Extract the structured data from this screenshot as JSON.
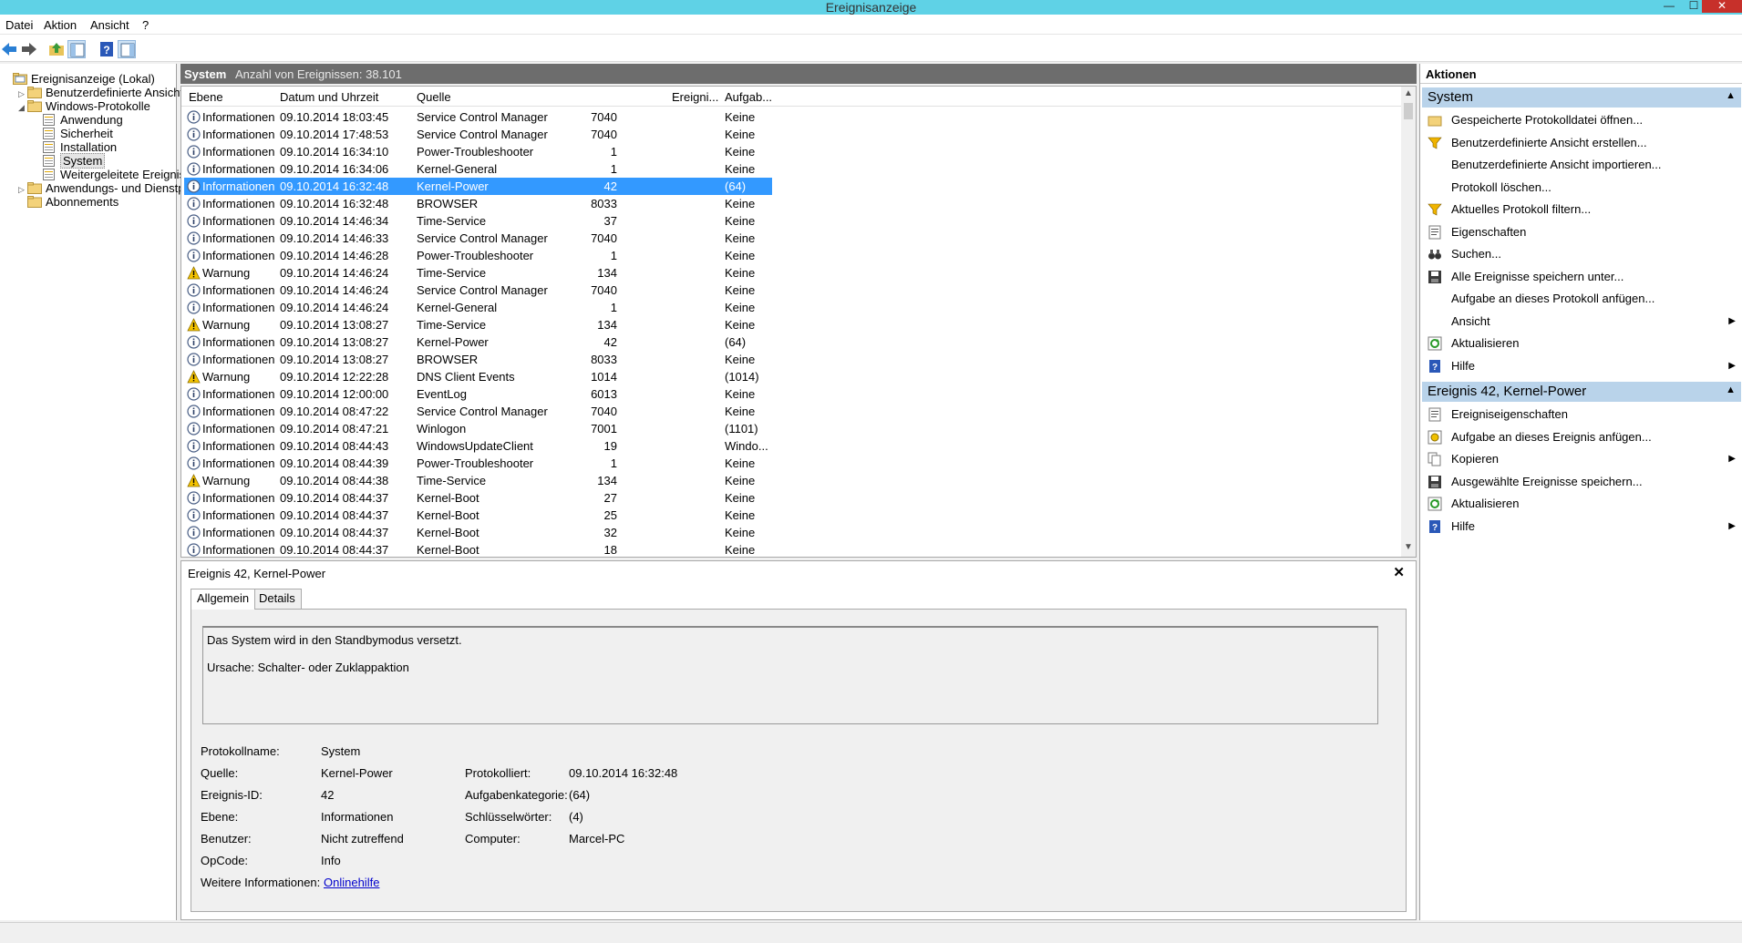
{
  "window": {
    "title": "Ereignisanzeige",
    "min": "—",
    "max": "☐",
    "close": "✕"
  },
  "menu": [
    "Datei",
    "Aktion",
    "Ansicht",
    "?"
  ],
  "tree": {
    "items": [
      {
        "label": "Ereignisanzeige (Lokal)",
        "level": 0,
        "expander": ""
      },
      {
        "label": "Benutzerdefinierte Ansichten",
        "level": 1,
        "expander": "▷"
      },
      {
        "label": "Windows-Protokolle",
        "level": 1,
        "expander": "◢"
      },
      {
        "label": "Anwendung",
        "level": 2,
        "expander": ""
      },
      {
        "label": "Sicherheit",
        "level": 2,
        "expander": ""
      },
      {
        "label": "Installation",
        "level": 2,
        "expander": ""
      },
      {
        "label": "System",
        "level": 2,
        "expander": "",
        "selected": true
      },
      {
        "label": "Weitergeleitete Ereignisse",
        "level": 2,
        "expander": ""
      },
      {
        "label": "Anwendungs- und Dienstprotokolle",
        "level": 1,
        "expander": "▷"
      },
      {
        "label": "Abonnements",
        "level": 1,
        "expander": ""
      }
    ],
    "scroll_left": "<",
    "scroll_right": ">"
  },
  "center": {
    "log_name": "System",
    "count_text": "Anzahl von Ereignissen: 38.101",
    "columns": [
      "Ebene",
      "Datum und Uhrzeit",
      "Quelle",
      "Ereigni...",
      "Aufgab..."
    ],
    "rows": [
      {
        "level": "Informationen",
        "type": "info",
        "datetime": "09.10.2014 18:03:45",
        "source": "Service Control Manager",
        "id": "7040",
        "category": "Keine"
      },
      {
        "level": "Informationen",
        "type": "info",
        "datetime": "09.10.2014 17:48:53",
        "source": "Service Control Manager",
        "id": "7040",
        "category": "Keine"
      },
      {
        "level": "Informationen",
        "type": "info",
        "datetime": "09.10.2014 16:34:10",
        "source": "Power-Troubleshooter",
        "id": "1",
        "category": "Keine"
      },
      {
        "level": "Informationen",
        "type": "info",
        "datetime": "09.10.2014 16:34:06",
        "source": "Kernel-General",
        "id": "1",
        "category": "Keine"
      },
      {
        "level": "Informationen",
        "type": "info",
        "datetime": "09.10.2014 16:32:48",
        "source": "Kernel-Power",
        "id": "42",
        "category": "(64)",
        "selected": true
      },
      {
        "level": "Informationen",
        "type": "info",
        "datetime": "09.10.2014 16:32:48",
        "source": "BROWSER",
        "id": "8033",
        "category": "Keine"
      },
      {
        "level": "Informationen",
        "type": "info",
        "datetime": "09.10.2014 14:46:34",
        "source": "Time-Service",
        "id": "37",
        "category": "Keine"
      },
      {
        "level": "Informationen",
        "type": "info",
        "datetime": "09.10.2014 14:46:33",
        "source": "Service Control Manager",
        "id": "7040",
        "category": "Keine"
      },
      {
        "level": "Informationen",
        "type": "info",
        "datetime": "09.10.2014 14:46:28",
        "source": "Power-Troubleshooter",
        "id": "1",
        "category": "Keine"
      },
      {
        "level": "Warnung",
        "type": "warn",
        "datetime": "09.10.2014 14:46:24",
        "source": "Time-Service",
        "id": "134",
        "category": "Keine"
      },
      {
        "level": "Informationen",
        "type": "info",
        "datetime": "09.10.2014 14:46:24",
        "source": "Service Control Manager",
        "id": "7040",
        "category": "Keine"
      },
      {
        "level": "Informationen",
        "type": "info",
        "datetime": "09.10.2014 14:46:24",
        "source": "Kernel-General",
        "id": "1",
        "category": "Keine"
      },
      {
        "level": "Warnung",
        "type": "warn",
        "datetime": "09.10.2014 13:08:27",
        "source": "Time-Service",
        "id": "134",
        "category": "Keine"
      },
      {
        "level": "Informationen",
        "type": "info",
        "datetime": "09.10.2014 13:08:27",
        "source": "Kernel-Power",
        "id": "42",
        "category": "(64)"
      },
      {
        "level": "Informationen",
        "type": "info",
        "datetime": "09.10.2014 13:08:27",
        "source": "BROWSER",
        "id": "8033",
        "category": "Keine"
      },
      {
        "level": "Warnung",
        "type": "warn",
        "datetime": "09.10.2014 12:22:28",
        "source": "DNS Client Events",
        "id": "1014",
        "category": "(1014)"
      },
      {
        "level": "Informationen",
        "type": "info",
        "datetime": "09.10.2014 12:00:00",
        "source": "EventLog",
        "id": "6013",
        "category": "Keine"
      },
      {
        "level": "Informationen",
        "type": "info",
        "datetime": "09.10.2014 08:47:22",
        "source": "Service Control Manager",
        "id": "7040",
        "category": "Keine"
      },
      {
        "level": "Informationen",
        "type": "info",
        "datetime": "09.10.2014 08:47:21",
        "source": "Winlogon",
        "id": "7001",
        "category": "(1101)"
      },
      {
        "level": "Informationen",
        "type": "info",
        "datetime": "09.10.2014 08:44:43",
        "source": "WindowsUpdateClient",
        "id": "19",
        "category": "Windo..."
      },
      {
        "level": "Informationen",
        "type": "info",
        "datetime": "09.10.2014 08:44:39",
        "source": "Power-Troubleshooter",
        "id": "1",
        "category": "Keine"
      },
      {
        "level": "Warnung",
        "type": "warn",
        "datetime": "09.10.2014 08:44:38",
        "source": "Time-Service",
        "id": "134",
        "category": "Keine"
      },
      {
        "level": "Informationen",
        "type": "info",
        "datetime": "09.10.2014 08:44:37",
        "source": "Kernel-Boot",
        "id": "27",
        "category": "Keine"
      },
      {
        "level": "Informationen",
        "type": "info",
        "datetime": "09.10.2014 08:44:37",
        "source": "Kernel-Boot",
        "id": "25",
        "category": "Keine"
      },
      {
        "level": "Informationen",
        "type": "info",
        "datetime": "09.10.2014 08:44:37",
        "source": "Kernel-Boot",
        "id": "32",
        "category": "Keine"
      },
      {
        "level": "Informationen",
        "type": "info",
        "datetime": "09.10.2014 08:44:37",
        "source": "Kernel-Boot",
        "id": "18",
        "category": "Keine"
      }
    ]
  },
  "detail": {
    "title": "Ereignis 42, Kernel-Power",
    "close": "✕",
    "tabs": [
      "Allgemein",
      "Details"
    ],
    "message_line1": "Das System wird in den Standbymodus versetzt.",
    "message_line2": "Ursache: Schalter- oder Zuklappaktion",
    "fields": {
      "protokollname_label": "Protokollname:",
      "protokollname": "System",
      "quelle_label": "Quelle:",
      "quelle": "Kernel-Power",
      "protokolliert_label": "Protokolliert:",
      "protokolliert": "09.10.2014 16:32:48",
      "ereignisid_label": "Ereignis-ID:",
      "ereignisid": "42",
      "aufgabe_label": "Aufgabenkategorie:",
      "aufgabe": "(64)",
      "ebene_label": "Ebene:",
      "ebene": "Informationen",
      "schluessel_label": "Schlüsselwörter:",
      "schluessel": "(4)",
      "benutzer_label": "Benutzer:",
      "benutzer": "Nicht zutreffend",
      "computer_label": "Computer:",
      "computer": "Marcel-PC",
      "opcode_label": "OpCode:",
      "opcode": "Info",
      "weitere_label": "Weitere Informationen:",
      "weitere_link": "Onlinehilfe"
    }
  },
  "actions": {
    "title": "Aktionen",
    "section1": {
      "title": "System",
      "items": [
        {
          "label": "Gespeicherte Protokolldatei öffnen...",
          "icon": "folder-open-icon",
          "sub": false
        },
        {
          "label": "Benutzerdefinierte Ansicht erstellen...",
          "icon": "filter-icon",
          "sub": false
        },
        {
          "label": "Benutzerdefinierte Ansicht importieren...",
          "icon": "",
          "sub": false
        },
        {
          "label": "Protokoll löschen...",
          "icon": "",
          "sub": false
        },
        {
          "label": "Aktuelles Protokoll filtern...",
          "icon": "filter-icon",
          "sub": false
        },
        {
          "label": "Eigenschaften",
          "icon": "properties-icon",
          "sub": false
        },
        {
          "label": "Suchen...",
          "icon": "binoculars-icon",
          "sub": false
        },
        {
          "label": "Alle Ereignisse speichern unter...",
          "icon": "save-icon",
          "sub": false
        },
        {
          "label": "Aufgabe an dieses Protokoll anfügen...",
          "icon": "",
          "sub": false
        },
        {
          "label": "Ansicht",
          "icon": "",
          "sub": true
        },
        {
          "label": "Aktualisieren",
          "icon": "refresh-icon",
          "sub": false
        },
        {
          "label": "Hilfe",
          "icon": "help-icon",
          "sub": true
        }
      ]
    },
    "section2": {
      "title": "Ereignis 42, Kernel-Power",
      "items": [
        {
          "label": "Ereigniseigenschaften",
          "icon": "properties-icon",
          "sub": false
        },
        {
          "label": "Aufgabe an dieses Ereignis anfügen...",
          "icon": "task-icon",
          "sub": false
        },
        {
          "label": "Kopieren",
          "icon": "copy-icon",
          "sub": true
        },
        {
          "label": "Ausgewählte Ereignisse speichern...",
          "icon": "save-icon",
          "sub": false
        },
        {
          "label": "Aktualisieren",
          "icon": "refresh-icon",
          "sub": false
        },
        {
          "label": "Hilfe",
          "icon": "help-icon",
          "sub": true
        }
      ]
    }
  },
  "colors": {
    "titlebar": "#5fd2e6",
    "selection": "#3399ff",
    "section_header": "#b9d3ea",
    "header_bar": "#6d6d6d"
  }
}
